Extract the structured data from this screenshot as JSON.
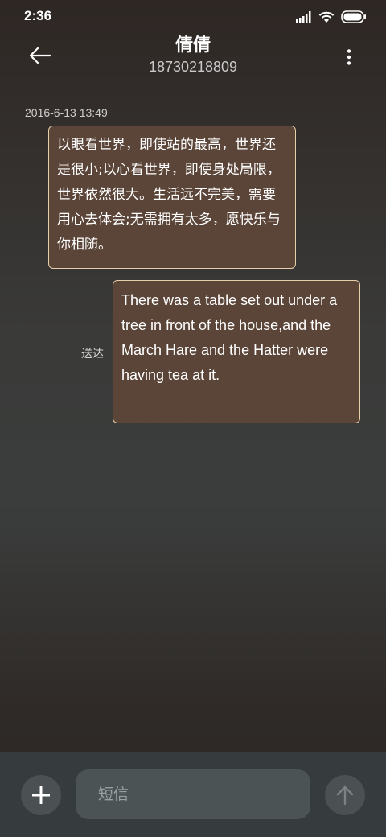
{
  "status_bar": {
    "time": "2:36",
    "icons": [
      "signal-icon",
      "wifi-icon",
      "battery-icon"
    ]
  },
  "header": {
    "contact_name": "倩倩",
    "contact_number": "18730218809",
    "back_icon": "back-arrow-icon",
    "more_icon": "more-vertical-icon"
  },
  "conversation": {
    "timestamp": "2016-6-13 13:49",
    "messages": [
      {
        "direction": "incoming",
        "text": "以眼看世界，即使站的最高，世界还是很小;以心看世界，即使身处局限，世界依然很大。生活远不完美，需要用心去体会;无需拥有太多，愿快乐与你相随。"
      },
      {
        "direction": "outgoing",
        "text": "There was a table set out under a tree in front of the house,and the March Hare and the Hatter were having tea at it.",
        "status": "送达"
      }
    ]
  },
  "composer": {
    "placeholder": "短信",
    "value": "",
    "add_icon": "plus-icon",
    "send_icon": "send-arrow-icon"
  },
  "colors": {
    "bubble_background": "#5b4538",
    "bubble_border": "#e7cfa9",
    "composer_background": "#363c3d",
    "button_background": "#4b5152"
  }
}
